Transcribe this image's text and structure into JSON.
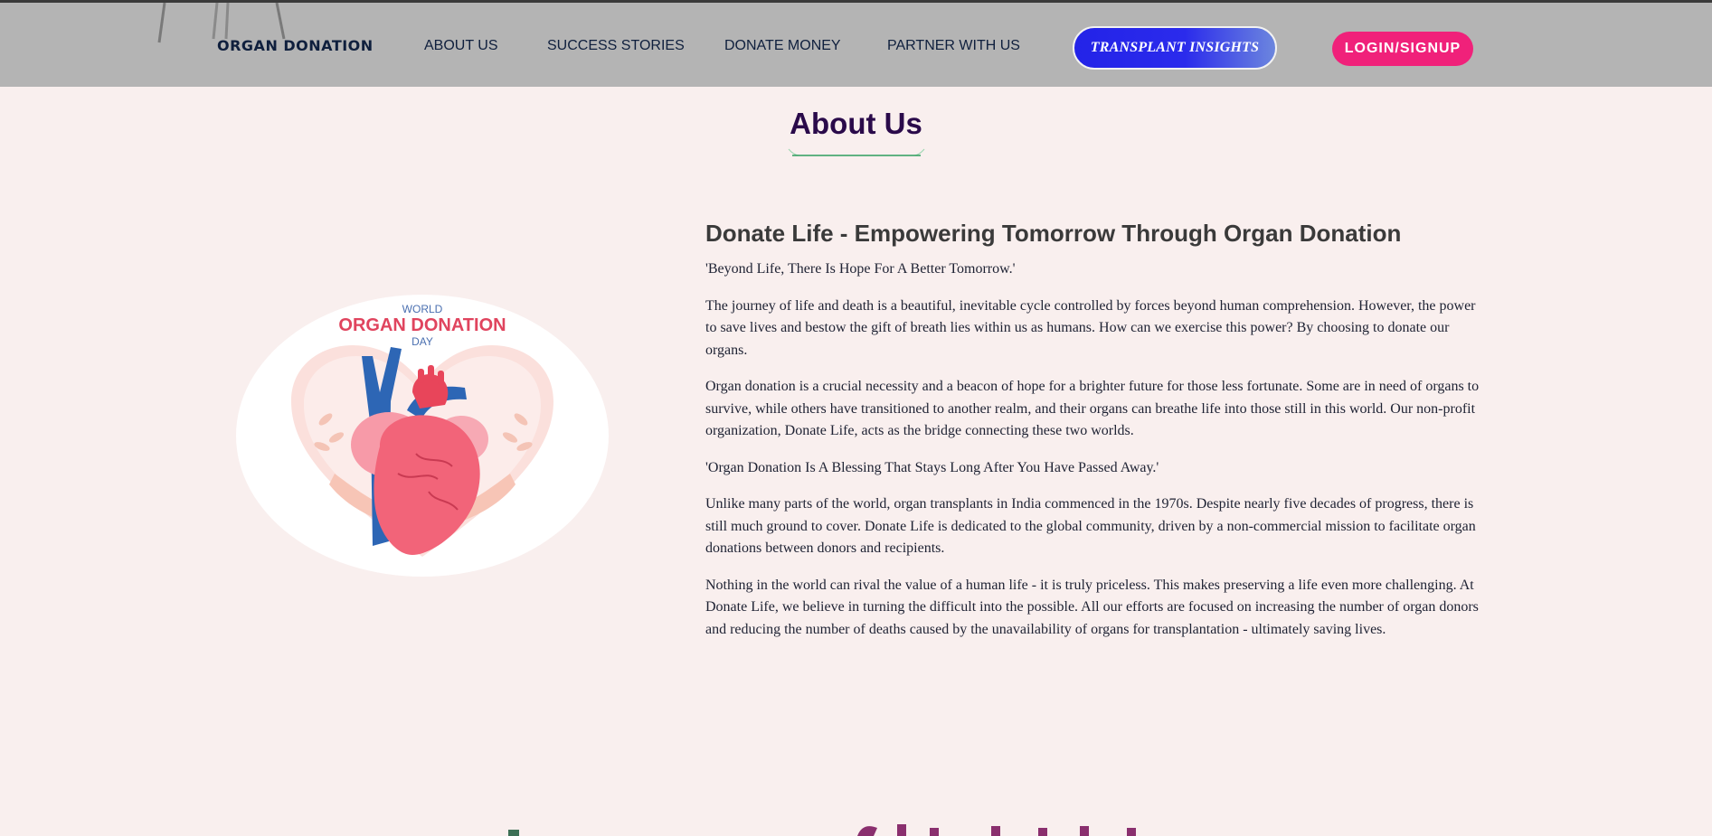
{
  "nav": {
    "logo": "ORGAN DONATION",
    "links": [
      "ABOUT US",
      "SUCCESS STORIES",
      "DONATE MONEY",
      "PARTNER WITH US"
    ],
    "insights_label": "TRANSPLANT INSIGHTS",
    "login_label": "LOGIN/SIGNUP"
  },
  "colors": {
    "nav_bg": "#b4b4b4",
    "page_bg": "#f9efee",
    "insights_gradient": [
      "#2323e8",
      "#6c86de"
    ],
    "login_bg": "#f0217a",
    "title": "#2a0a4a"
  },
  "section": {
    "title": "About Us"
  },
  "illustration": {
    "line1": "WORLD",
    "line2": "ORGAN DONATION",
    "line3": "DAY"
  },
  "about": {
    "heading": "Donate Life - Empowering Tomorrow Through Organ Donation",
    "paragraphs": [
      "'Beyond Life, There Is Hope For A Better Tomorrow.'",
      "The journey of life and death is a beautiful, inevitable cycle controlled by forces beyond human comprehension. However, the power to save lives and bestow the gift of breath lies within us as humans. How can we exercise this power? By choosing to donate our organs.",
      "Organ donation is a crucial necessity and a beacon of hope for a brighter future for those less fortunate. Some are in need of organs to survive, while others have transitioned to another realm, and their organs can breathe life into those still in this world. Our non-profit organization, Donate Life, acts as the bridge connecting these two worlds.",
      "'Organ Donation Is A Blessing That Stays Long After You Have Passed Away.'",
      "Unlike many parts of the world, organ transplants in India commenced in the 1970s. Despite nearly five decades of progress, there is still much ground to cover. Donate Life is dedicated to the global community, driven by a non-commercial mission to facilitate organ donations between donors and recipients.",
      "Nothing in the world can rival the value of a human life - it is truly priceless. This makes preserving a life even more challenging. At Donate Life, we believe in turning the difficult into the possible. All our efforts are focused on increasing the number of organ donors and reducing the number of deaths caused by the unavailability of organs for transplantation - ultimately saving lives."
    ]
  }
}
